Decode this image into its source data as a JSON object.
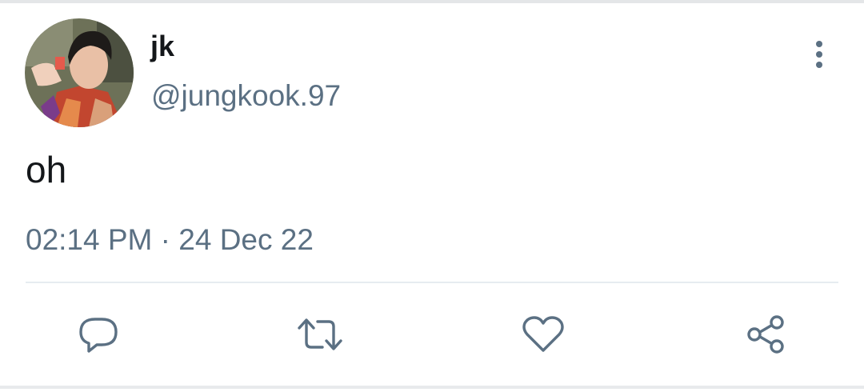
{
  "user": {
    "display_name": "jk",
    "handle": "@jungkook.97"
  },
  "tweet": {
    "text": "oh",
    "time": "02:14 PM",
    "separator": "·",
    "date": "24 Dec 22"
  },
  "actions": [
    {
      "icon": "reply-icon"
    },
    {
      "icon": "retweet-icon"
    },
    {
      "icon": "like-icon"
    },
    {
      "icon": "share-icon"
    }
  ],
  "colors": {
    "primary_text": "#14171a",
    "secondary_text": "#5b7083",
    "divider": "#e6ecf0",
    "background": "#ffffff"
  }
}
